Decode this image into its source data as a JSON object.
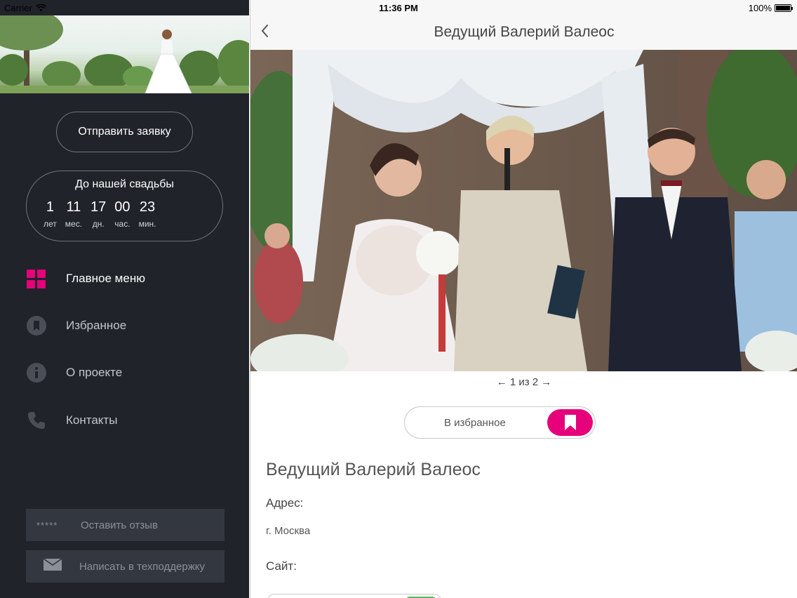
{
  "status_bar": {
    "carrier": "Carrier",
    "time": "11:36 PM",
    "battery": "100%",
    "battery_level": 1.0
  },
  "sidebar": {
    "request_button": "Отправить заявку",
    "countdown": {
      "title": "До нашей свадьбы",
      "units": [
        {
          "value": "1",
          "label": "лет"
        },
        {
          "value": "11",
          "label": "мес."
        },
        {
          "value": "17",
          "label": "дн."
        },
        {
          "value": "00",
          "label": "час."
        },
        {
          "value": "23",
          "label": "мин."
        }
      ]
    },
    "menu": [
      {
        "label": "Главное меню",
        "icon": "grid-icon",
        "active": true
      },
      {
        "label": "Избранное",
        "icon": "bookmark-icon",
        "active": false
      },
      {
        "label": "О проекте",
        "icon": "info-icon",
        "active": false
      },
      {
        "label": "Контакты",
        "icon": "phone-icon",
        "active": false
      }
    ],
    "footer": {
      "review_stars": "*****",
      "review_label": "Оставить отзыв",
      "support_label": "Написать в техподдержку"
    }
  },
  "main": {
    "nav_title": "Ведущий Валерий Валеос",
    "pager": "← 1 из 2 →",
    "favorite_label": "В избранное",
    "detail_title": "Ведущий Валерий Валеос",
    "address_label": "Адрес:",
    "address_value": "г. Москва",
    "site_label": "Сайт:"
  },
  "colors": {
    "accent": "#e6007a",
    "sidebar_bg": "#20232a",
    "footer_btn_bg": "#33373f"
  }
}
